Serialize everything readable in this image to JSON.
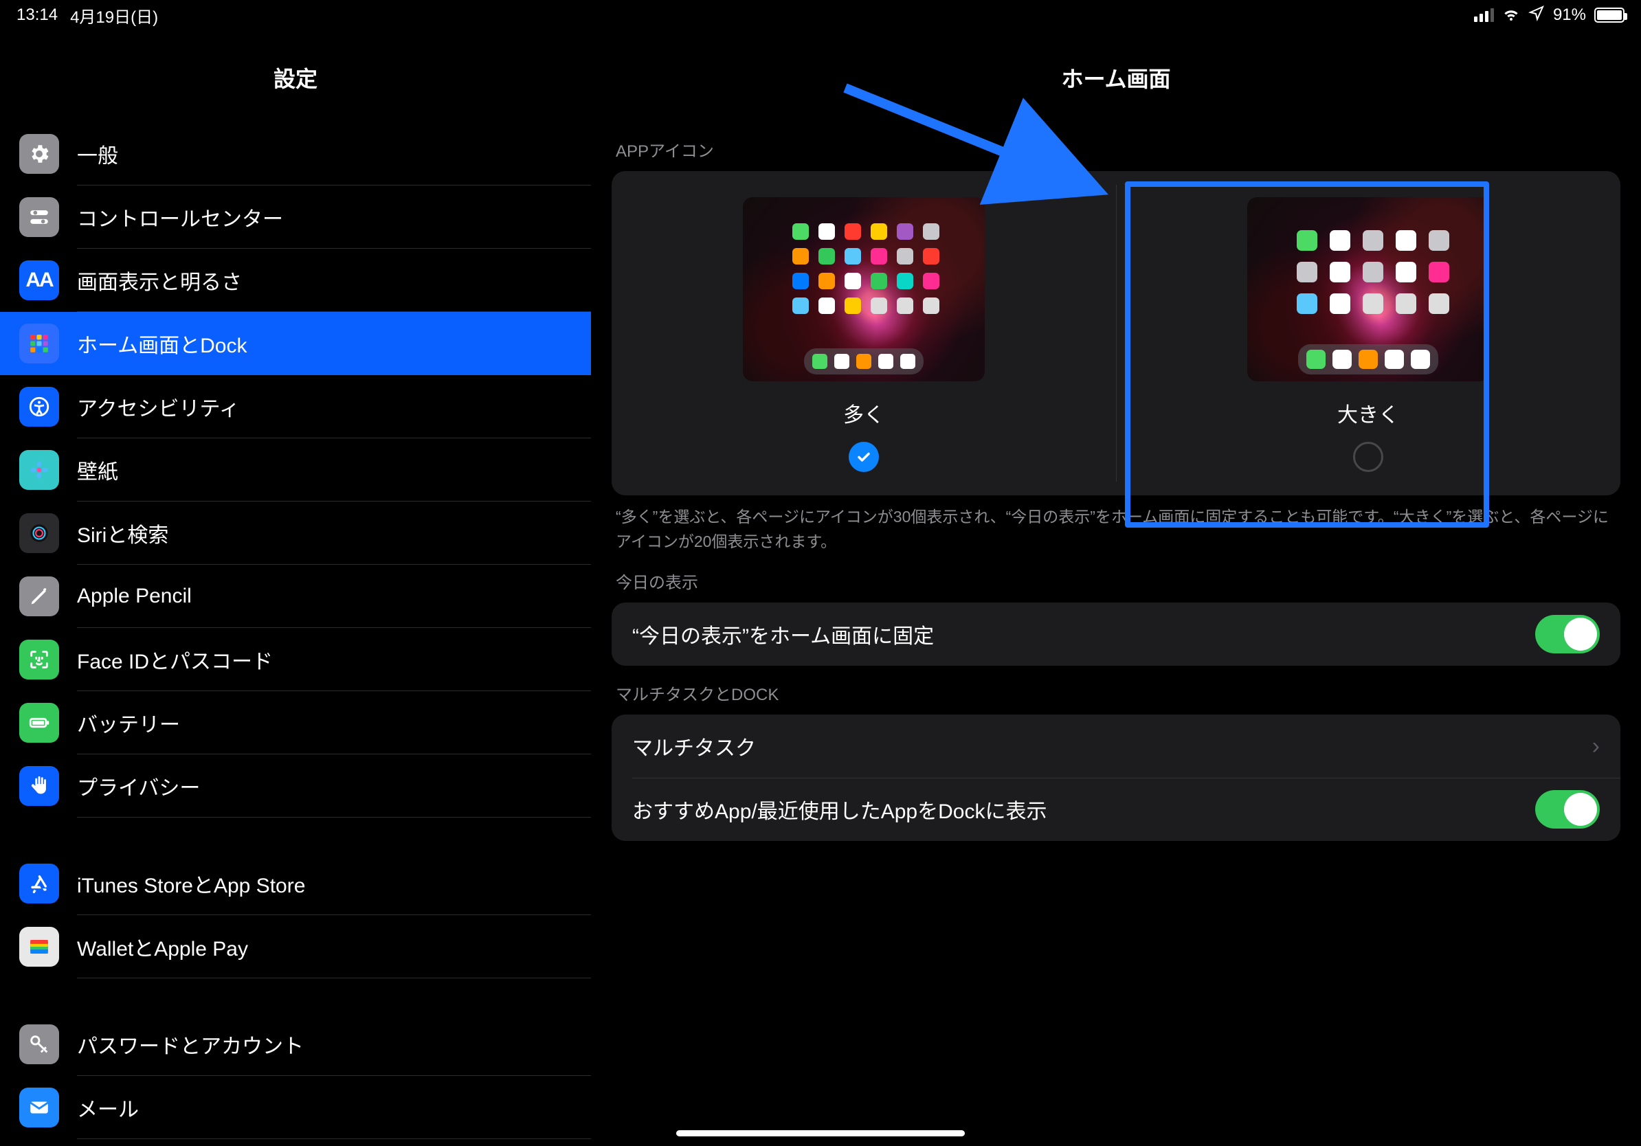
{
  "status": {
    "time": "13:14",
    "date": "4月19日(日)",
    "battery_pct": "91%"
  },
  "sidebar": {
    "title": "設定",
    "items": [
      {
        "label": "一般"
      },
      {
        "label": "コントロールセンター"
      },
      {
        "label": "画面表示と明るさ"
      },
      {
        "label": "ホーム画面とDock"
      },
      {
        "label": "アクセシビリティ"
      },
      {
        "label": "壁紙"
      },
      {
        "label": "Siriと検索"
      },
      {
        "label": "Apple Pencil"
      },
      {
        "label": "Face IDとパスコード"
      },
      {
        "label": "バッテリー"
      },
      {
        "label": "プライバシー"
      }
    ],
    "group2": [
      {
        "label": "iTunes StoreとApp Store"
      },
      {
        "label": "WalletとApple Pay"
      }
    ],
    "group3": [
      {
        "label": "パスワードとアカウント"
      },
      {
        "label": "メール"
      }
    ]
  },
  "detail": {
    "title": "ホーム画面",
    "app_icon_header": "APPアイコン",
    "choice_more": "多く",
    "choice_larger": "大きく",
    "selected_choice": "more",
    "app_icon_footer": "“多く”を選ぶと、各ページにアイコンが30個表示され、“今日の表示”をホーム画面に固定することも可能です。“大きく”を選ぶと、各ページにアイコンが20個表示されます。",
    "today_header": "今日の表示",
    "today_row": "“今日の表示”をホーム画面に固定",
    "today_on": true,
    "multi_header": "マルチタスクとDOCK",
    "multi_row": "マルチタスク",
    "dock_row": "おすすめApp/最近使用したAppをDockに表示",
    "dock_on": true
  },
  "colors": {
    "blue": "#0a60ff",
    "green": "#34c759"
  }
}
